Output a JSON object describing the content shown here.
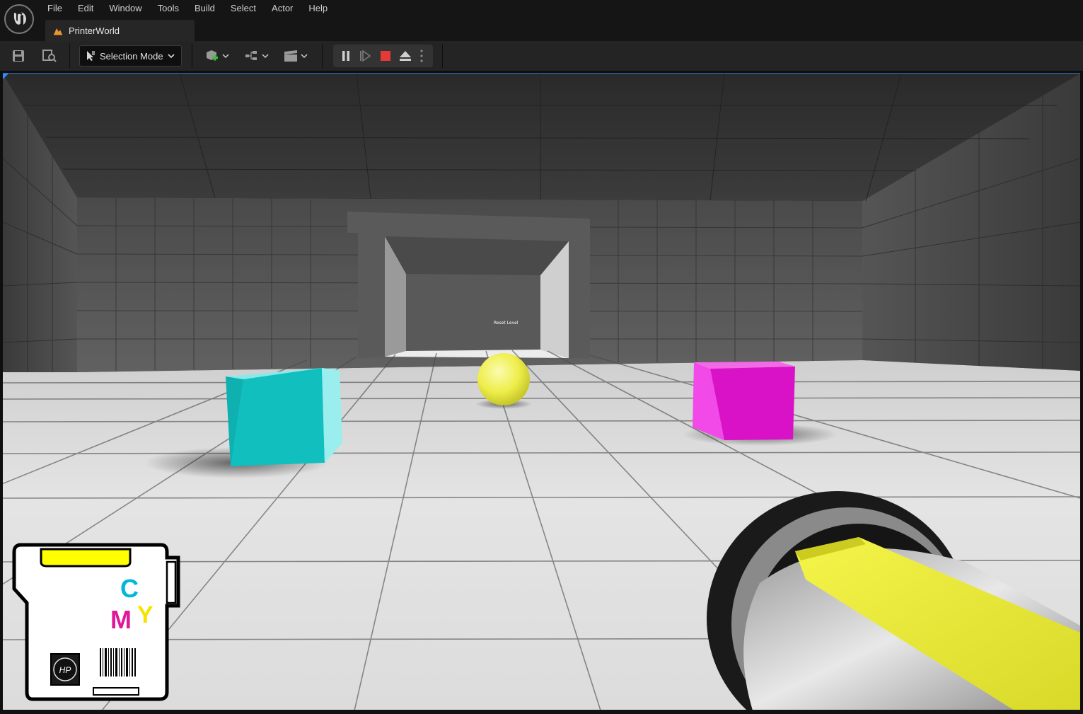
{
  "menu": {
    "items": [
      "File",
      "Edit",
      "Window",
      "Tools",
      "Build",
      "Select",
      "Actor",
      "Help"
    ]
  },
  "tab": {
    "level_name": "PrinterWorld"
  },
  "toolbar": {
    "selection_mode_label": "Selection Mode",
    "icons": [
      "save-icon",
      "content-browser-icon",
      "add-actor-icon",
      "blueprint-icon",
      "cinematics-icon"
    ],
    "play_controls": [
      "pause-icon",
      "step-frame-icon",
      "stop-icon",
      "eject-icon",
      "more-options-icon"
    ],
    "stop_color": "#e53935"
  },
  "viewport": {
    "world_text": "Reset Level",
    "objects": [
      {
        "name": "cyan-cube",
        "color": "#12bfbf"
      },
      {
        "name": "yellow-sphere",
        "color": "#f2f25a"
      },
      {
        "name": "magenta-cube",
        "color": "#e014cc"
      }
    ],
    "hud": {
      "ink_level_color": "#ffff00",
      "cartridge_logo_letters": [
        "C",
        "M",
        "Y"
      ],
      "brand_text": "HP"
    }
  }
}
